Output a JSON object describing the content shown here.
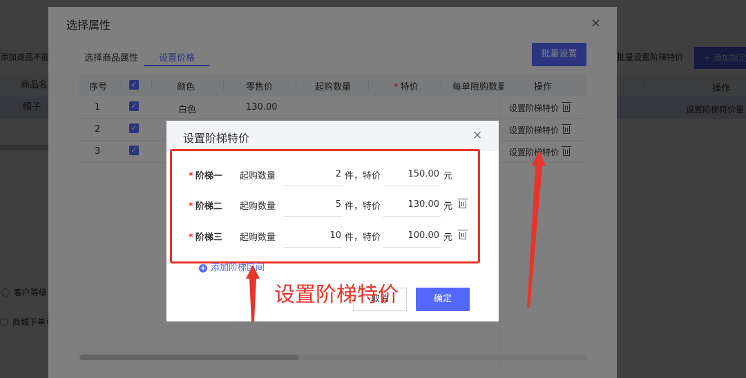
{
  "background": {
    "left_note": "添加商品不能",
    "left_header": "商品名",
    "left_row_value": "帽子",
    "radio_customer_level": "客户等级",
    "radio_mall_order": "商城下单可",
    "right_batch_link": "批量设置阶梯特价",
    "right_add_button": "+ 添加指定",
    "right_header_op": "操作",
    "right_row_op": "设置阶梯特价量"
  },
  "attr_dialog": {
    "title": "选择属性",
    "close_icon": "×",
    "tabs": [
      {
        "label": "选择商品属性",
        "active": false
      },
      {
        "label": "设置价格",
        "active": true
      }
    ],
    "batch_button": "批量设置",
    "columns": {
      "index": "序号",
      "color": "颜色",
      "retail_price": "零售价",
      "min_qty": "起购数量",
      "special_price": "特价",
      "limit_per_order": "每单限购数量",
      "actions": "操作"
    },
    "rows": [
      {
        "index": "1",
        "color": "白色",
        "retail_price": "130.00",
        "action": "设置阶梯特价"
      },
      {
        "index": "2",
        "color": "",
        "retail_price": "",
        "action": "设置阶梯特价"
      },
      {
        "index": "3",
        "color": "",
        "retail_price": "",
        "action": "设置阶梯特价"
      }
    ]
  },
  "tier_modal": {
    "title": "设置阶梯特价",
    "close_icon": "×",
    "qty_label": "起购数量",
    "unit_text": "件，特价",
    "currency": "元",
    "tiers": [
      {
        "label": "阶梯一",
        "qty": "2",
        "price": "150.00",
        "deletable": false
      },
      {
        "label": "阶梯二",
        "qty": "5",
        "price": "130.00",
        "deletable": true
      },
      {
        "label": "阶梯三",
        "qty": "10",
        "price": "100.00",
        "deletable": true
      }
    ],
    "add_range": "添加阶梯区间",
    "cancel": "取消",
    "confirm": "确定"
  },
  "annotation": {
    "text": "设置阶梯特价",
    "color": "#e8352b"
  },
  "colors": {
    "primary": "#5468ff",
    "annotation_red": "#e8352b"
  }
}
